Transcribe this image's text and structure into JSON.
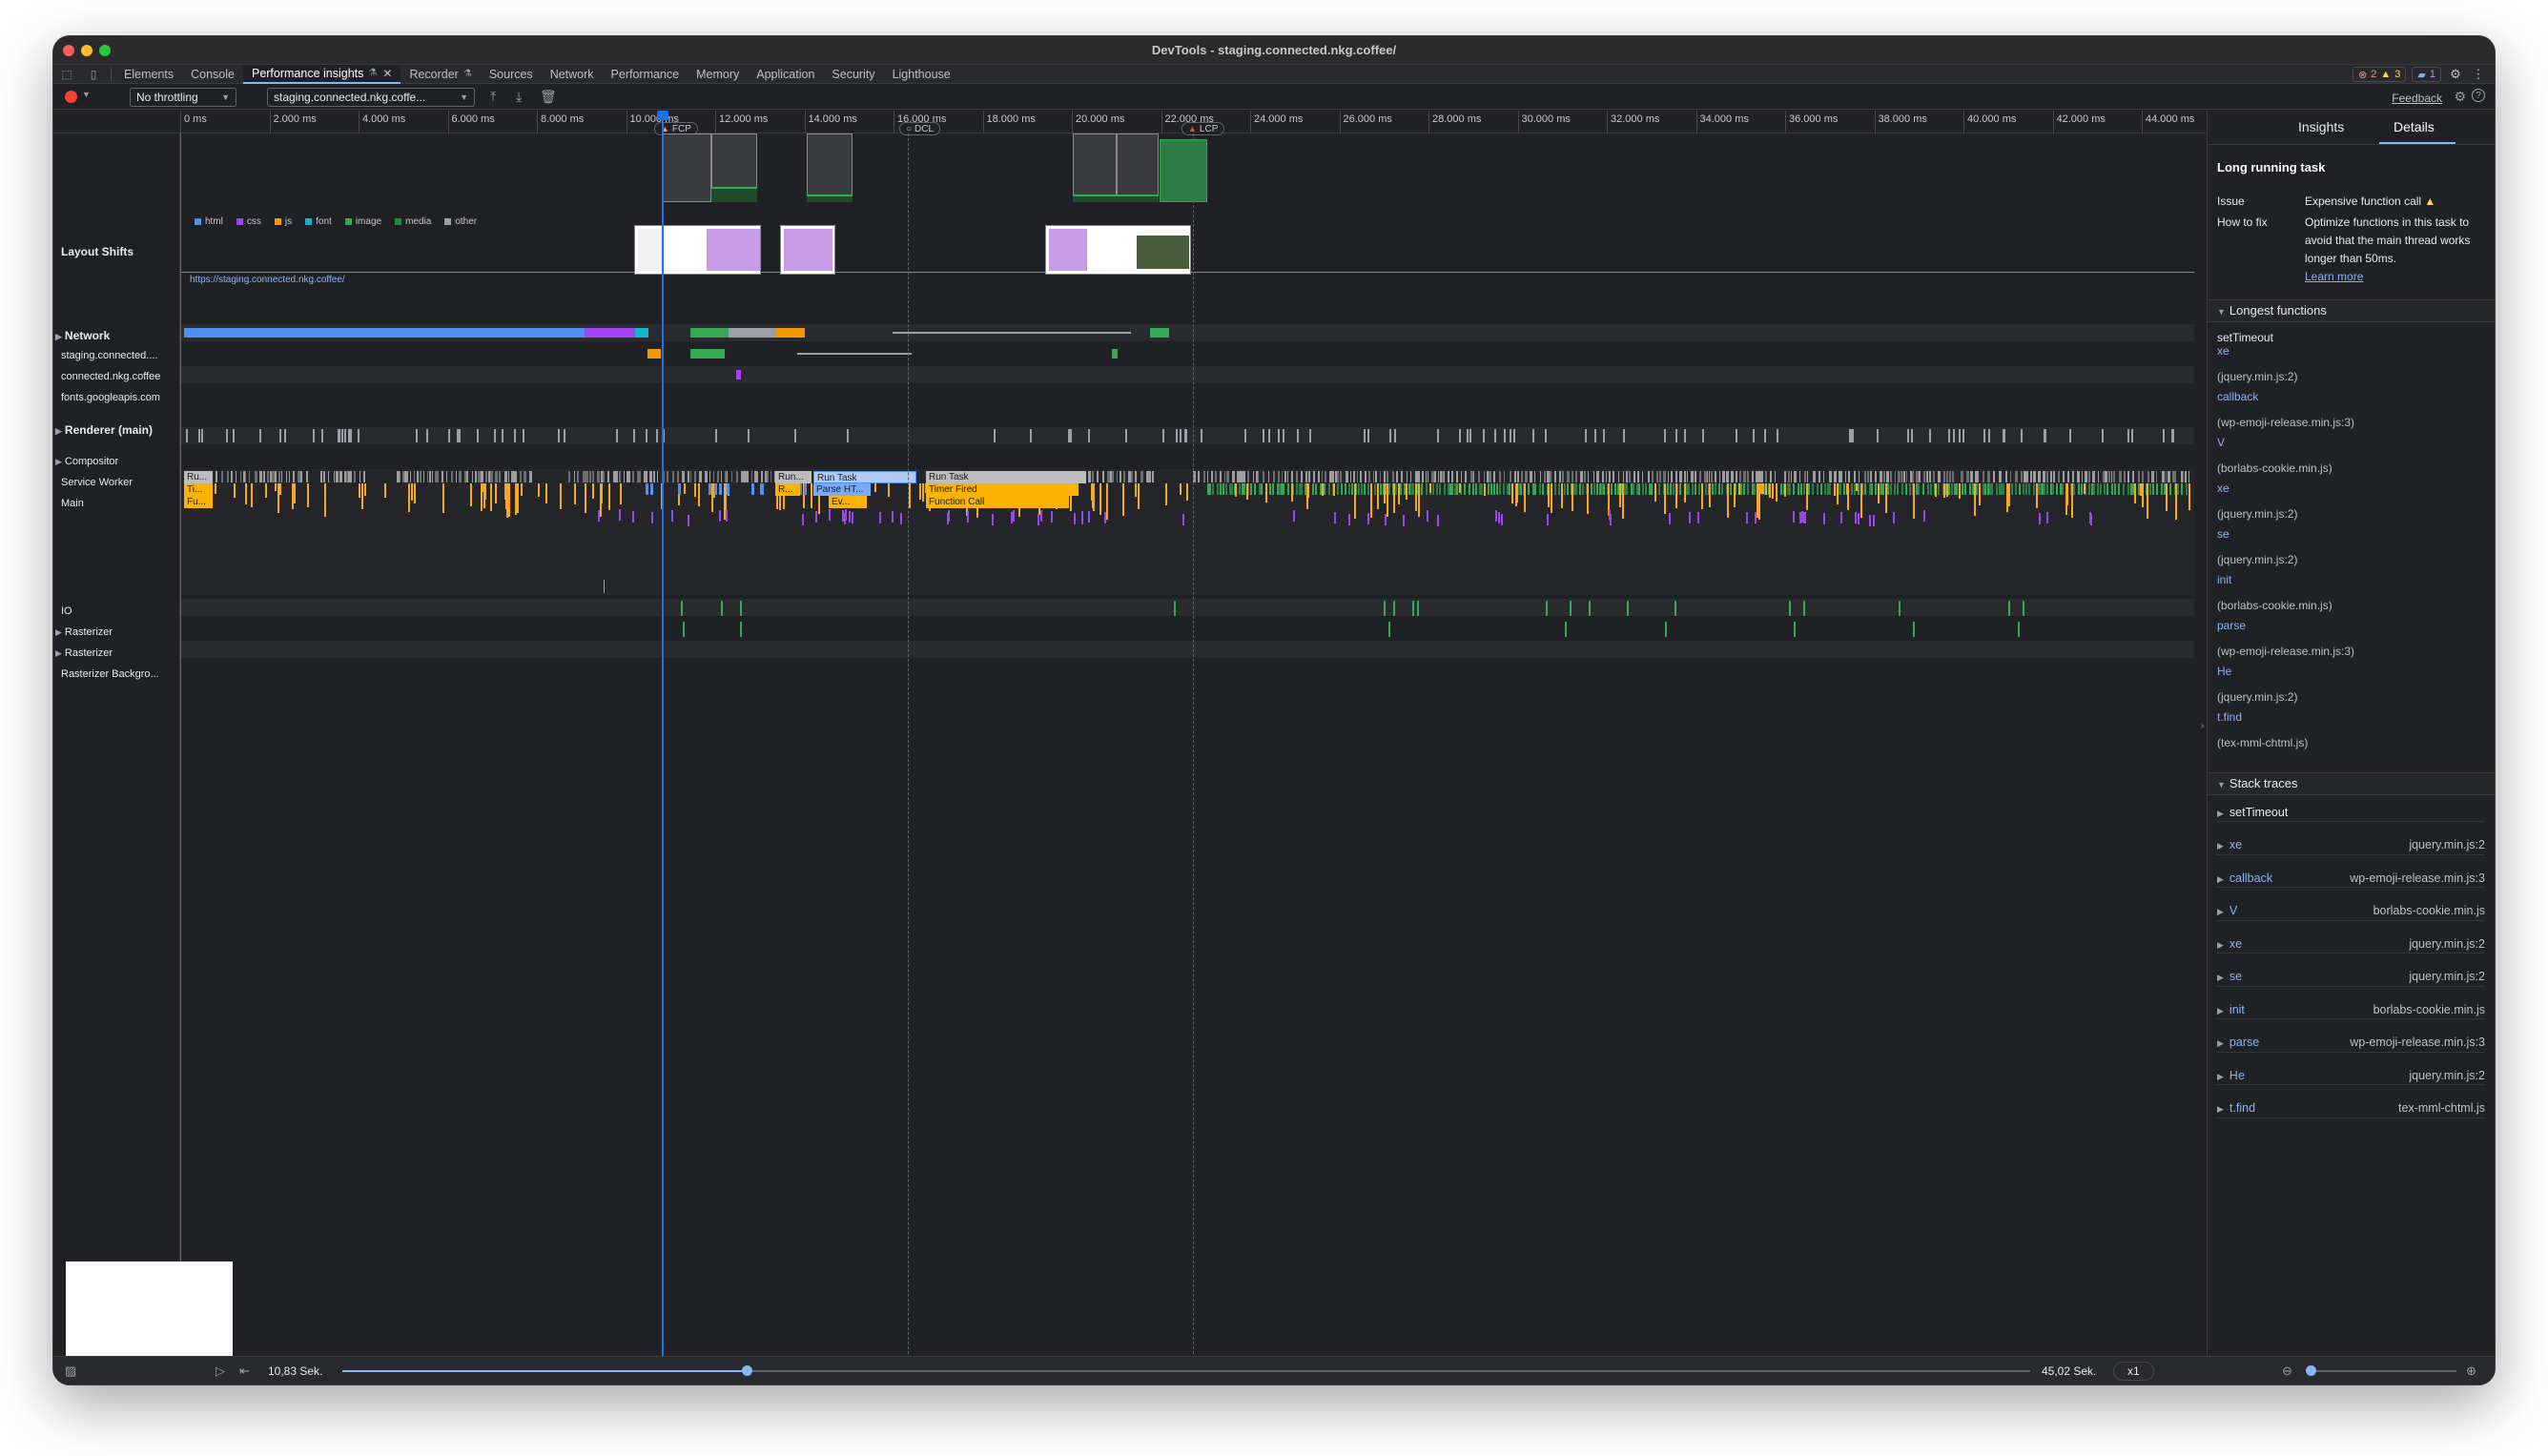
{
  "window": {
    "title": "DevTools - staging.connected.nkg.coffee/"
  },
  "tabs": [
    {
      "label": "Elements"
    },
    {
      "label": "Console"
    },
    {
      "label": "Performance insights",
      "active": true
    },
    {
      "label": "Recorder"
    },
    {
      "label": "Sources"
    },
    {
      "label": "Network"
    },
    {
      "label": "Performance"
    },
    {
      "label": "Memory"
    },
    {
      "label": "Application"
    },
    {
      "label": "Security"
    },
    {
      "label": "Lighthouse"
    }
  ],
  "status": {
    "errors": "2",
    "warnings": "3",
    "messages": "1"
  },
  "toolbar": {
    "throttling": "No throttling",
    "recording": "staging.connected.nkg.coffe...",
    "feedback": "Feedback"
  },
  "ruler": [
    "0 ms",
    "2.000 ms",
    "4.000 ms",
    "6.000 ms",
    "8.000 ms",
    "10.000 ms",
    "12.000 ms",
    "14.000 ms",
    "16.000 ms",
    "18.000 ms",
    "20.000 ms",
    "22.000 ms",
    "24.000 ms",
    "26.000 ms",
    "28.000 ms",
    "30.000 ms",
    "32.000 ms",
    "34.000 ms",
    "36.000 ms",
    "38.000 ms",
    "40.000 ms",
    "42.000 ms",
    "44.000 ms"
  ],
  "markers": {
    "fcp": "FCP",
    "dcl": "DCL",
    "lcp": "LCP"
  },
  "tracks": {
    "layout_shifts": "Layout Shifts",
    "network": "Network",
    "net_rows": [
      "staging.connected....",
      "connected.nkg.coffee",
      "fonts.googleapis.com"
    ],
    "renderer": "Renderer (main)",
    "renderer_url": "https://staging.connected.nkg.coffee/",
    "compositor": "Compositor",
    "service_worker": "Service Worker",
    "main": "Main",
    "io": "IO",
    "rasterizer1": "Rasterizer",
    "rasterizer2": "Rasterizer",
    "raster_bg": "Rasterizer Backgro..."
  },
  "legend": [
    {
      "label": "html",
      "color": "#4e8ff0"
    },
    {
      "label": "css",
      "color": "#a142f4"
    },
    {
      "label": "js",
      "color": "#f29900"
    },
    {
      "label": "font",
      "color": "#12b5cb"
    },
    {
      "label": "image",
      "color": "#34a853"
    },
    {
      "label": "media",
      "color": "#1e8e3e"
    },
    {
      "label": "other",
      "color": "#9aa0a6"
    }
  ],
  "main_events": {
    "r1": [
      "Ru...",
      "Run...",
      "Run Task",
      "Run Task"
    ],
    "r2": [
      "Ti...",
      "R...",
      "Parse HT...",
      "Timer Fired"
    ],
    "r3": [
      "Fu...",
      "Ev...",
      "Function Call"
    ],
    "dots": "..."
  },
  "playback": {
    "current": "10,83 Sek.",
    "total": "45,02 Sek.",
    "speed": "x1"
  },
  "sidebar": {
    "tabs": [
      "Insights",
      "Details"
    ],
    "title": "Long running task",
    "issue_label": "Issue",
    "issue_value": "Expensive function call",
    "fix_label": "How to fix",
    "fix_value": "Optimize functions in this task to avoid that the main thread works longer than 50ms.",
    "learn_more": "Learn more",
    "longest_title": "Longest functions",
    "longest": [
      {
        "text": "setTimeout",
        "kind": "plain"
      },
      {
        "text": "xe",
        "kind": "name"
      },
      {
        "text": "(jquery.min.js:2)",
        "kind": "src"
      },
      {
        "text": "callback",
        "kind": "name"
      },
      {
        "text": "(wp-emoji-release.min.js:3)",
        "kind": "src"
      },
      {
        "text": "V",
        "kind": "name"
      },
      {
        "text": "(borlabs-cookie.min.js)",
        "kind": "src"
      },
      {
        "text": "xe",
        "kind": "name"
      },
      {
        "text": "(jquery.min.js:2)",
        "kind": "src"
      },
      {
        "text": "se",
        "kind": "name"
      },
      {
        "text": "(jquery.min.js:2)",
        "kind": "src"
      },
      {
        "text": "init",
        "kind": "name"
      },
      {
        "text": "(borlabs-cookie.min.js)",
        "kind": "src"
      },
      {
        "text": "parse",
        "kind": "name"
      },
      {
        "text": "(wp-emoji-release.min.js:3)",
        "kind": "src"
      },
      {
        "text": "He",
        "kind": "name"
      },
      {
        "text": "(jquery.min.js:2)",
        "kind": "src"
      },
      {
        "text": "t.find",
        "kind": "name"
      },
      {
        "text": "(tex-mml-chtml.js)",
        "kind": "src"
      }
    ],
    "stack_title": "Stack traces",
    "stack": [
      {
        "fn": "setTimeout",
        "src": ""
      },
      {
        "fn": "xe",
        "src": "jquery.min.js:2"
      },
      {
        "fn": "callback",
        "src": "wp-emoji-release.min.js:3"
      },
      {
        "fn": "V",
        "src": "borlabs-cookie.min.js"
      },
      {
        "fn": "xe",
        "src": "jquery.min.js:2"
      },
      {
        "fn": "se",
        "src": "jquery.min.js:2"
      },
      {
        "fn": "init",
        "src": "borlabs-cookie.min.js"
      },
      {
        "fn": "parse",
        "src": "wp-emoji-release.min.js:3"
      },
      {
        "fn": "He",
        "src": "jquery.min.js:2"
      },
      {
        "fn": "t.find",
        "src": "tex-mml-chtml.js"
      }
    ]
  }
}
